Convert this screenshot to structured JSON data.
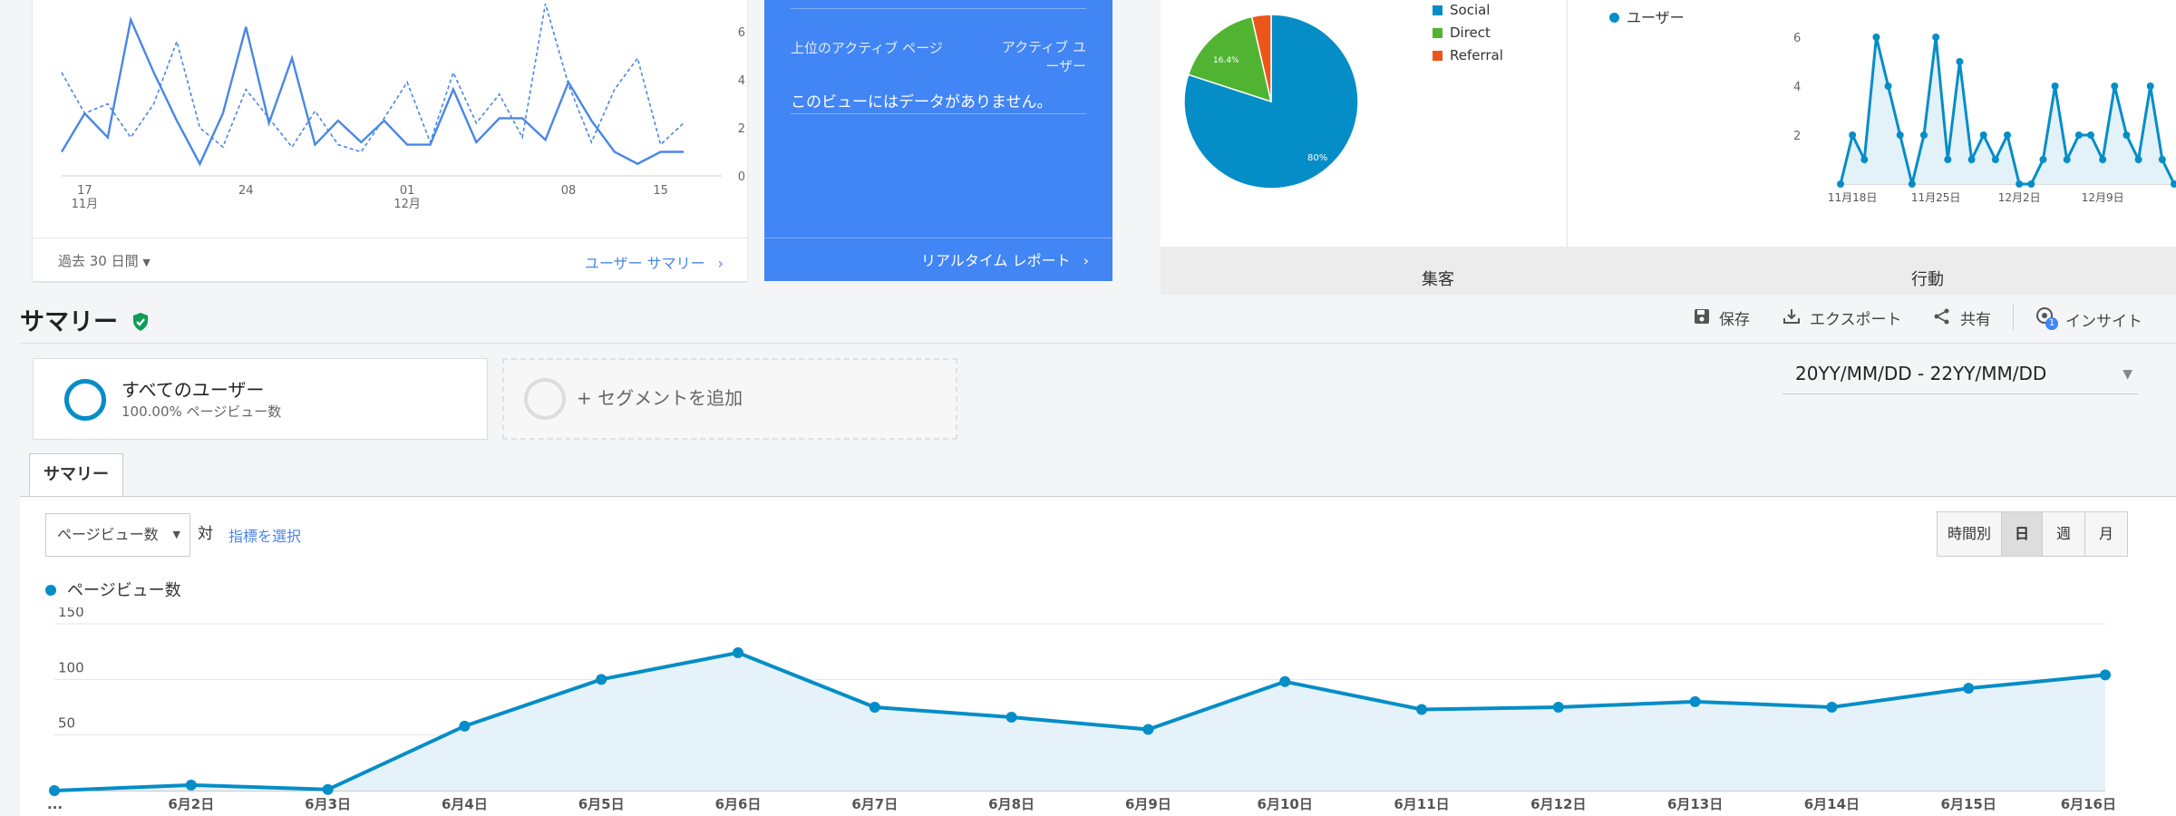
{
  "top_left_card": {
    "y_ticks": [
      "6",
      "4",
      "2",
      "0"
    ],
    "x_ticks": [
      {
        "day": "17",
        "month": "11月"
      },
      {
        "day": "24",
        "month": ""
      },
      {
        "day": "01",
        "month": "12月"
      },
      {
        "day": "08",
        "month": ""
      },
      {
        "day": "15",
        "month": ""
      }
    ],
    "range_label": "過去 30 日間",
    "link_label": "ユーザー サマリー",
    "solid_series": [
      1,
      2.6,
      1.6,
      6.5,
      4.3,
      2.3,
      0.5,
      2.6,
      6.2,
      2.2,
      4.9,
      1.3,
      2.3,
      1.4,
      2.3,
      1.3,
      1.3,
      3.6,
      1.4,
      2.4,
      2.4,
      1.5,
      3.9,
      2.3,
      1,
      0.5,
      1,
      1
    ],
    "dashed_series": [
      4.3,
      2.6,
      3,
      1.6,
      3,
      5.6,
      2,
      1.2,
      3.6,
      2.4,
      1.2,
      2.7,
      1.3,
      1,
      2.4,
      3.9,
      1.4,
      4.3,
      2.2,
      3.4,
      1.6,
      7.3,
      3.8,
      1.4,
      3.6,
      4.9,
      1.3,
      2.2
    ]
  },
  "realtime_card": {
    "col1_header": "上位のアクティブ ページ",
    "col2_header_line1": "アクティブ ユ",
    "col2_header_line2": "ーザー",
    "empty_message": "このビューにはデータがありません。",
    "footer_link": "リアルタイム レポート",
    "bg_color": "#4285f4"
  },
  "channels_card": {
    "legend": [
      {
        "label": "Social",
        "color": "#058dc7"
      },
      {
        "label": "Direct",
        "color": "#50b432"
      },
      {
        "label": "Referral",
        "color": "#ed561b"
      }
    ],
    "pie_percentages": [
      80,
      16.4,
      3.6
    ],
    "pie_labels": [
      "80%",
      "16.4%"
    ],
    "users_legend": "ユーザー",
    "users_y_ticks": [
      "6",
      "4",
      "2"
    ],
    "users_x_ticks": [
      "11月18日",
      "11月25日",
      "12月2日",
      "12月9日"
    ],
    "users_series": [
      0,
      2,
      1,
      6,
      4,
      2,
      0,
      2,
      6,
      1,
      5,
      1,
      2,
      1,
      2,
      0,
      0,
      1,
      4,
      1,
      2,
      2,
      1,
      4,
      2,
      1,
      4,
      1,
      0
    ],
    "tab_acquisition": "集客",
    "tab_behavior": "行動"
  },
  "summary": {
    "title": "サマリー",
    "save_label": "保存",
    "export_label": "エクスポート",
    "share_label": "共有",
    "insight_label": "インサイト",
    "insight_badge": "1",
    "segment_all_title": "すべてのユーザー",
    "segment_all_sub": "100.00% ページビュー数",
    "segment_add": "+ セグメントを追加",
    "date_range": "20YY/MM/DD - 22YY/MM/DD",
    "tab": "サマリー",
    "metric_select": "ページビュー数",
    "vs_label": "対",
    "pick_metric": "指標を選択",
    "toggle_hourly": "時間別",
    "toggle_day": "日",
    "toggle_week": "週",
    "toggle_month": "月",
    "active_toggle": "日",
    "accent_color": "#058dc7"
  },
  "chart_data": {
    "type": "area",
    "series": [
      {
        "name": "ページビュー数",
        "values": [
          0,
          5,
          1,
          58,
          100,
          124,
          75,
          66,
          55,
          98,
          73,
          75,
          80,
          75,
          92,
          104
        ]
      }
    ],
    "x": [
      "...",
      "6月2日",
      "6月3日",
      "6月4日",
      "6月5日",
      "6月6日",
      "6月7日",
      "6月8日",
      "6月9日",
      "6月10日",
      "6月11日",
      "6月12日",
      "6月13日",
      "6月14日",
      "6月15日",
      "6月16日"
    ],
    "y_ticks": [
      "150",
      "100",
      "50"
    ],
    "ylim": [
      0,
      150
    ],
    "grid": true
  }
}
